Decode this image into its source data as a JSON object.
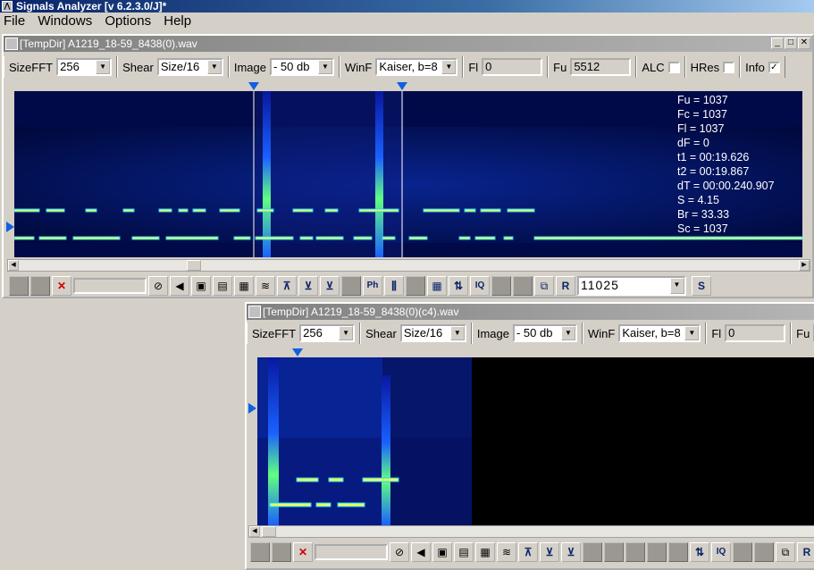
{
  "app": {
    "title": "Signals Analyzer [v 6.2.3.0/J]*"
  },
  "menu": [
    "File",
    "Windows",
    "Options",
    "Help"
  ],
  "win1": {
    "title": "[TempDir] A1219_18-59_8438(0).wav",
    "controls": {
      "sizefft_label": "SizeFFT",
      "sizefft_value": "256",
      "shear_label": "Shear",
      "shear_value": "Size/16",
      "image_label": "Image",
      "image_value": "- 50 db",
      "winf_label": "WinF",
      "winf_value": "Kaiser, b=8",
      "fl_label": "Fl",
      "fl_value": "0",
      "fu_label": "Fu",
      "fu_value": "5512",
      "alc_label": "ALC",
      "alc_checked": false,
      "hres_label": "HRes",
      "hres_checked": false,
      "info_label": "Info",
      "info_checked": true
    },
    "info": [
      "Fu = 1037",
      "Fc = 1037",
      "Fl = 1037",
      "dF = 0",
      "t1 = 00:19.626",
      "t2 = 00:19.867",
      "dT = 00:00.240.907",
      "S = 4.15",
      "Br = 33.33",
      "Sc = 1037"
    ],
    "samplerate": "11025",
    "s_button": "S"
  },
  "win2": {
    "title": "[TempDir] A1219_18-59_8438(0)(c4).wav",
    "controls": {
      "sizefft_label": "SizeFFT",
      "sizefft_value": "256",
      "shear_label": "Shear",
      "shear_value": "Size/16",
      "image_label": "Image",
      "image_value": "- 50 db",
      "winf_label": "WinF",
      "winf_value": "Kaiser, b=8",
      "fl_label": "Fl",
      "fl_value": "0",
      "fu_label": "Fu"
    }
  },
  "toolbar_icons": {
    "ph": "Ph",
    "iq": "IQ",
    "r": "R"
  },
  "colors": {
    "spectrogram_bg": "#000030",
    "signal": "#e8ff60",
    "marker": "#1060e0"
  }
}
